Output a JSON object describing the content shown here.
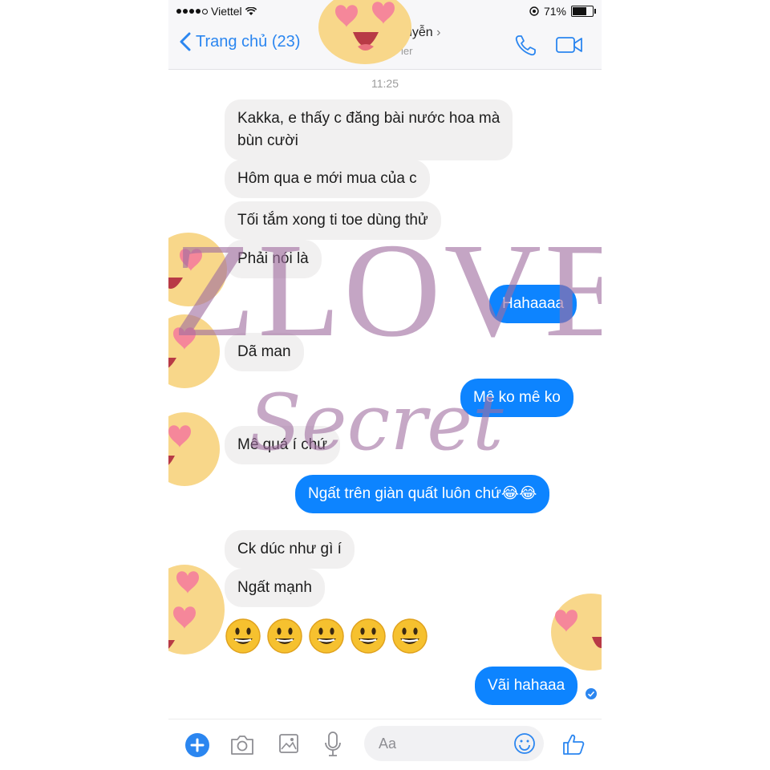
{
  "status_bar": {
    "carrier": "Viettel",
    "battery_percent": "71%",
    "battery_level": 0.71
  },
  "header": {
    "back_label": "Trang chủ (23)",
    "contact_name": "uyễn",
    "contact_subtitle": "ler"
  },
  "conversation": {
    "timestamp": "11:25",
    "messages": [
      {
        "from": "them",
        "text": [
          "Kakka, e thấy c đăng bài nước hoa mà",
          "bùn cười"
        ]
      },
      {
        "from": "them",
        "text": "Hôm qua e mới mua của c"
      },
      {
        "from": "them",
        "text": "Tối tắm xong ti toe dùng thử"
      },
      {
        "from": "them",
        "text": "Phải nói là"
      },
      {
        "from": "me",
        "text": "Hahaaaa"
      },
      {
        "from": "them",
        "text": "Dã man"
      },
      {
        "from": "me",
        "text": "Mê ko mê ko"
      },
      {
        "from": "them",
        "text": "Mê quá í chứ"
      },
      {
        "from": "me",
        "text": "Ngất trên giàn quất luôn chứ😂😂"
      },
      {
        "from": "them",
        "text": "Ck dúc như gì í"
      },
      {
        "from": "them",
        "text": "Ngất mạnh"
      },
      {
        "from": "them",
        "emoji_count": 5,
        "emoji": "grinning-face"
      },
      {
        "from": "me",
        "text": "Vãi hahaaa"
      }
    ]
  },
  "composer": {
    "placeholder": "Aa"
  },
  "watermark": {
    "main": "ZLOVE",
    "script": "Secret"
  },
  "colors": {
    "accent": "#0d84ff",
    "incoming_bubble": "#f1f0f0",
    "watermark": "#a06ea0"
  },
  "icons": [
    "back-chevron-icon",
    "phone-icon",
    "video-camera-icon",
    "plus-icon",
    "camera-icon",
    "image-icon",
    "microphone-icon",
    "emoji-icon",
    "thumbs-up-icon",
    "seen-check-icon"
  ]
}
